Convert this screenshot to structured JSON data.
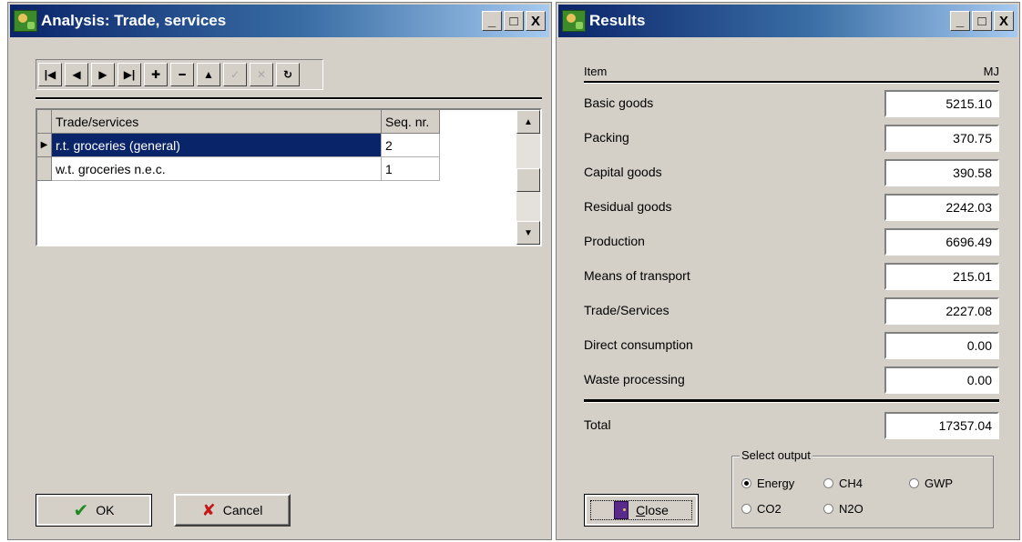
{
  "analysis_window": {
    "title": "Analysis: Trade, services",
    "caption_buttons": [
      "_",
      "□",
      "X"
    ],
    "toolbar_icons": [
      "first-record-icon",
      "prior-record-icon",
      "next-record-icon",
      "last-record-icon",
      "insert-record-icon",
      "delete-record-icon",
      "edit-record-icon",
      "post-edit-icon",
      "cancel-edit-icon",
      "refresh-icon"
    ],
    "grid": {
      "columns": [
        "Trade/services",
        "Seq. nr."
      ],
      "rows": [
        {
          "name": "r.t. groceries (general)",
          "seq": "2",
          "selected": true
        },
        {
          "name": "w.t. groceries n.e.c.",
          "seq": "1",
          "selected": false
        }
      ]
    },
    "ok_label": "OK",
    "cancel_label": "Cancel"
  },
  "results_window": {
    "title": "Results",
    "caption_buttons": [
      "_",
      "□",
      "X"
    ],
    "header": {
      "item": "Item",
      "unit": "MJ"
    },
    "rows": [
      {
        "label": "Basic goods",
        "value": "5215.10"
      },
      {
        "label": "Packing",
        "value": "370.75"
      },
      {
        "label": "Capital goods",
        "value": "390.58"
      },
      {
        "label": "Residual goods",
        "value": "2242.03"
      },
      {
        "label": "Production",
        "value": "6696.49"
      },
      {
        "label": "Means of transport",
        "value": "215.01"
      },
      {
        "label": "Trade/Services",
        "value": "2227.08"
      },
      {
        "label": "Direct consumption",
        "value": "0.00"
      },
      {
        "label": "Waste processing",
        "value": "0.00"
      }
    ],
    "total": {
      "label": "Total",
      "value": "17357.04"
    },
    "select_output": {
      "title": "Select output",
      "options": [
        "Energy",
        "CH4",
        "GWP",
        "CO2",
        "N2O"
      ],
      "selected": "Energy"
    },
    "close_label": "Close"
  }
}
